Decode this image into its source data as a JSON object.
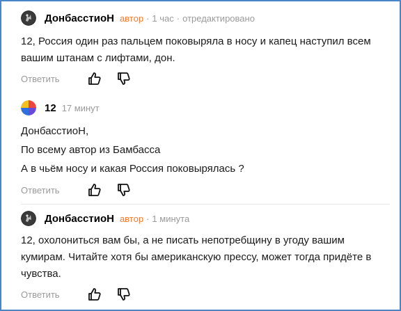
{
  "comments": [
    {
      "author": "ДонбасстиоН",
      "badge": "автор",
      "time": "1 час",
      "edited": "отредактировано",
      "avatar": "dark-figure-avatar",
      "paragraphs": [
        "12, Россия один раз пальцем поковыряла в носу и капец наступил всем вашим штанам с лифтами, дон."
      ],
      "reply_label": "Ответить"
    },
    {
      "author": "12",
      "time": "17 минут",
      "avatar": "colorful-pie-avatar",
      "paragraphs": [
        "ДонбасстиоН,",
        "По всему автор из Бамбасса",
        "А в чьём носу и какая Россия поковырялась ?"
      ],
      "reply_label": "Ответить"
    },
    {
      "author": "ДонбасстиоН",
      "badge": "автор",
      "time": "1 минута",
      "avatar": "dark-figure-avatar",
      "paragraphs": [
        "12, охолониться вам бы, а не писать непотребщину в угоду вашим кумирам. Читайте хотя бы американскую прессу, может тогда придёте в чувства."
      ],
      "reply_label": "Ответить"
    }
  ],
  "colors": {
    "border": "#4a86c7",
    "author_badge": "#f07c2e",
    "meta": "#9a9a9a",
    "text": "#1a1a1a"
  },
  "icons": {
    "like": "thumbs-up-icon",
    "dislike": "thumbs-down-icon"
  }
}
